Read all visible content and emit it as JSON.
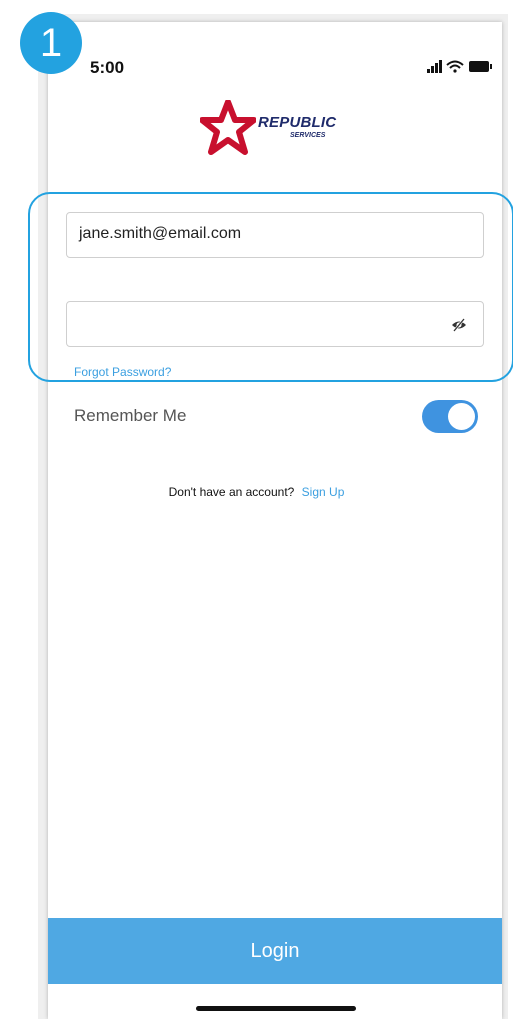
{
  "step": {
    "number": "1"
  },
  "status_bar": {
    "time": "5:00",
    "icons": [
      "signal-icon",
      "wifi-icon",
      "battery-icon"
    ]
  },
  "brand": {
    "name": "REPUBLIC",
    "sub": "SERVICES",
    "colors": {
      "red": "#c8102e",
      "navy": "#1f2b6b"
    }
  },
  "form": {
    "email_value": "jane.smith@email.com",
    "password_value": "",
    "forgot_password_label": "Forgot Password?",
    "remember_label": "Remember Me",
    "remember_on": true
  },
  "signup": {
    "prompt": "Don't have an account?",
    "link_label": "Sign Up"
  },
  "login_button_label": "Login",
  "accent_color": "#23a2e0"
}
